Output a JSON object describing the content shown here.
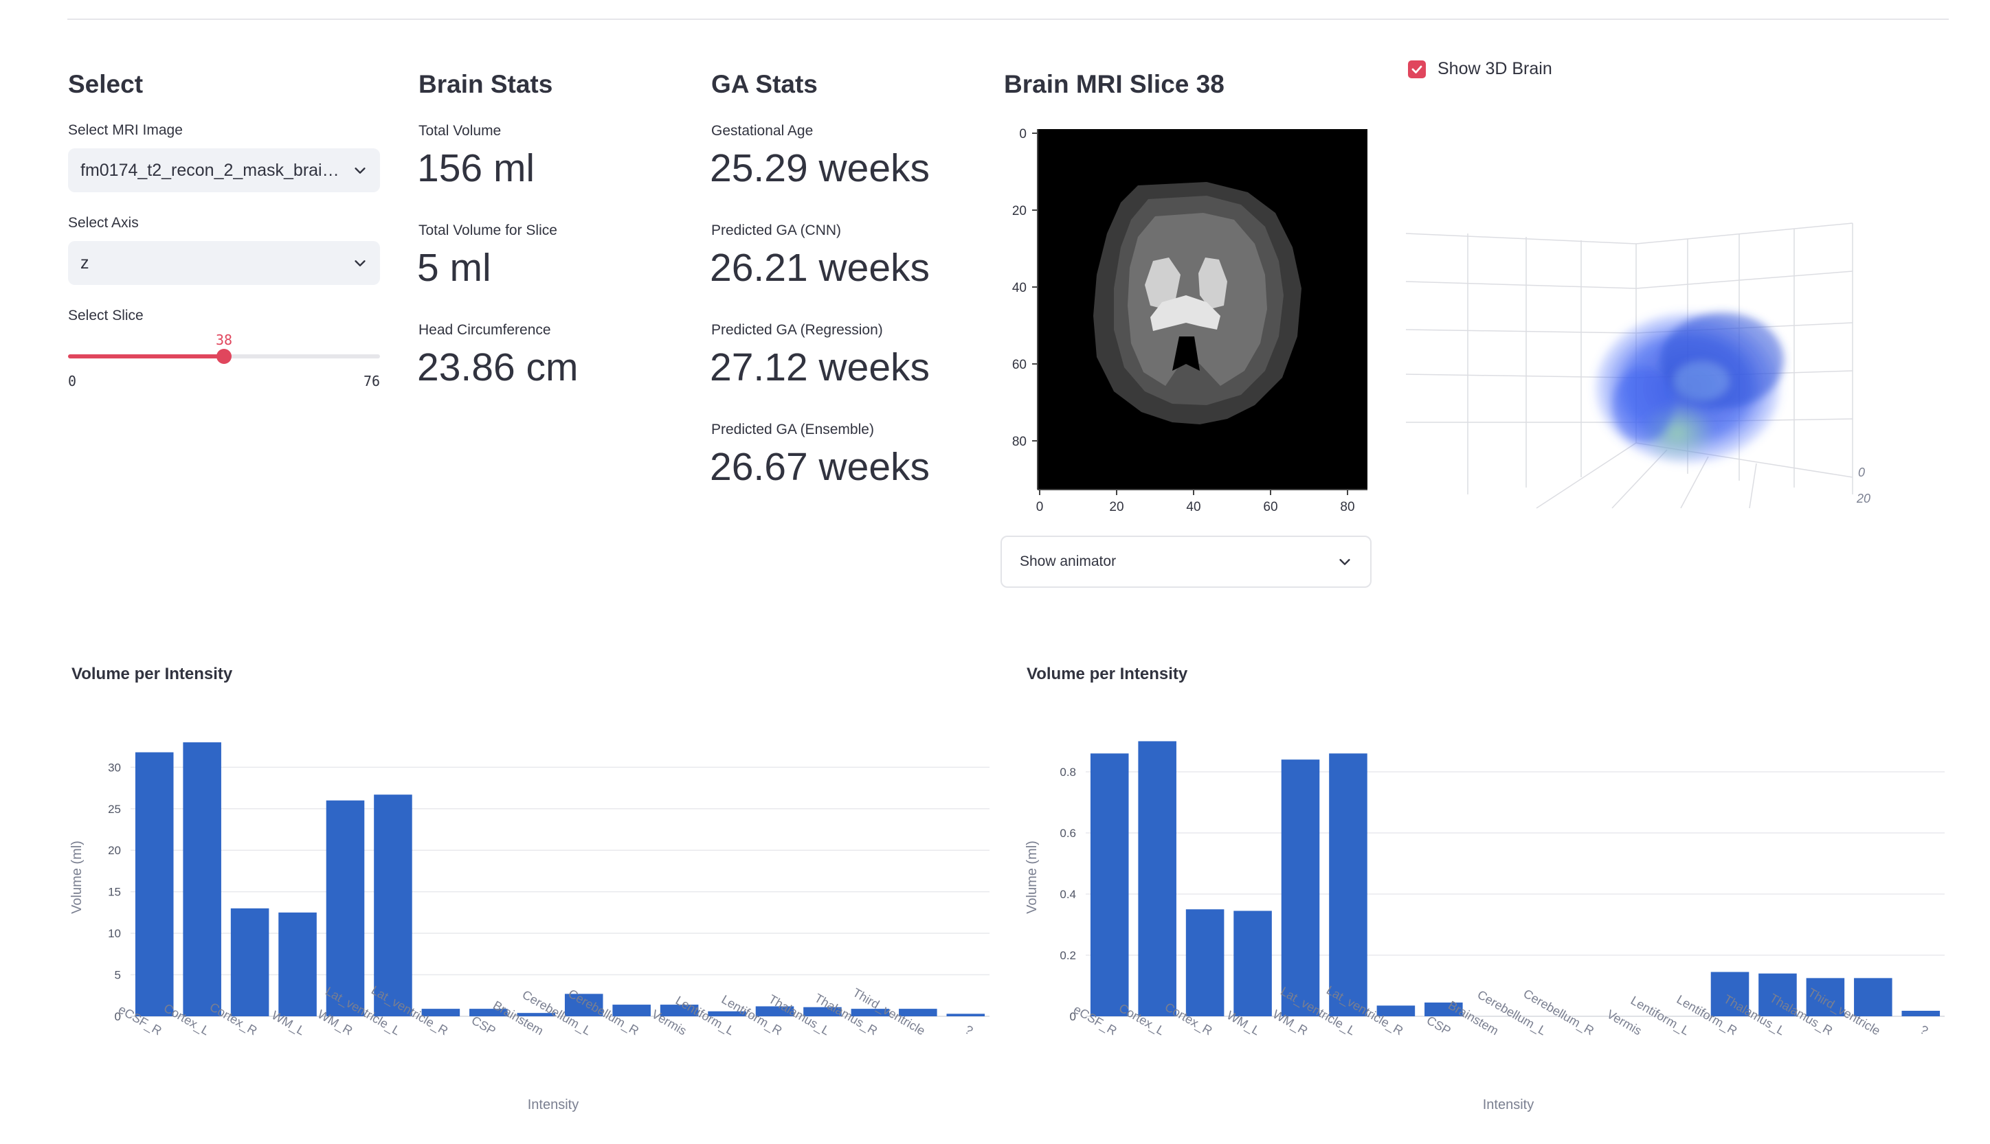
{
  "select_panel": {
    "title": "Select",
    "mri_label": "Select MRI Image",
    "mri_value": "fm0174_t2_recon_2_mask_brain...",
    "axis_label": "Select Axis",
    "axis_value": "z",
    "slice_label": "Select Slice",
    "slice_value": "38",
    "slice_value_num": 38,
    "slice_min": "0",
    "slice_max": "76",
    "slice_max_num": 76,
    "accent_color": "#e0465d"
  },
  "brain_stats": {
    "title": "Brain Stats",
    "total_volume_label": "Total Volume",
    "total_volume_value": "156 ml",
    "slice_volume_label": "Total Volume for Slice",
    "slice_volume_value": "5 ml",
    "head_circ_label": "Head Circumference",
    "head_circ_value": "23.86 cm"
  },
  "ga_stats": {
    "title": "GA Stats",
    "ga_label": "Gestational Age",
    "ga_value": "25.29 weeks",
    "cnn_label": "Predicted GA (CNN)",
    "cnn_value": "26.21 weeks",
    "reg_label": "Predicted GA (Regression)",
    "reg_value": "27.12 weeks",
    "ens_label": "Predicted GA (Ensemble)",
    "ens_value": "26.67 weeks"
  },
  "mri_slice": {
    "title": "Brain MRI Slice 38",
    "y_ticks": [
      "0",
      "20",
      "40",
      "60",
      "80"
    ],
    "x_ticks": [
      "0",
      "20",
      "40",
      "60",
      "80"
    ],
    "expander_label": "Show animator"
  },
  "brain3d": {
    "checkbox_label": "Show 3D Brain",
    "checked": true,
    "tick_labels": [
      "0",
      "20"
    ]
  },
  "chart_data": [
    {
      "type": "bar",
      "title": "Volume per Intensity",
      "xlabel": "Intensity",
      "ylabel": "Volume (ml)",
      "categories": [
        "eCSF_R",
        "Cortex_L",
        "Cortex_R",
        "WM_L",
        "WM_R",
        "Lat_ventricle_L",
        "Lat_ventricle_R",
        "CSP",
        "Brainstem",
        "Cerebellum_L",
        "Cerebellum_R",
        "Vermis",
        "Lentiform_L",
        "Lentiform_R",
        "Thalamus_L",
        "Thalamus_R",
        "Third_ventricle",
        "?"
      ],
      "values": [
        31.8,
        33.0,
        13.0,
        12.5,
        26.0,
        26.7,
        0.9,
        0.9,
        0.4,
        2.7,
        1.4,
        1.4,
        0.6,
        1.2,
        1.1,
        0.9,
        0.9,
        0.3
      ],
      "ylim": [
        0,
        33.5
      ],
      "yticks": [
        0,
        5,
        10,
        15,
        20,
        25,
        30
      ],
      "bar_color": "#2f66c6",
      "grid": true
    },
    {
      "type": "bar",
      "title": "Volume per Intensity",
      "xlabel": "Intensity",
      "ylabel": "Volume (ml)",
      "categories": [
        "eCSF_R",
        "Cortex_L",
        "Cortex_R",
        "WM_L",
        "WM_R",
        "Lat_ventricle_L",
        "Lat_ventricle_R",
        "CSP",
        "Brainstem",
        "Cerebellum_L",
        "Cerebellum_R",
        "Vermis",
        "Lentiform_L",
        "Lentiform_R",
        "Thalamus_L",
        "Thalamus_R",
        "Third_ventricle",
        "?"
      ],
      "values": [
        0.86,
        0.9,
        0.35,
        0.345,
        0.84,
        0.86,
        0.035,
        0.045,
        0,
        0,
        0,
        0,
        0,
        0.145,
        0.14,
        0.125,
        0.125,
        0.018
      ],
      "ylim": [
        0,
        0.91
      ],
      "yticks": [
        0,
        0.2,
        0.4,
        0.6,
        0.8
      ],
      "bar_color": "#2f66c6",
      "grid": true
    }
  ]
}
